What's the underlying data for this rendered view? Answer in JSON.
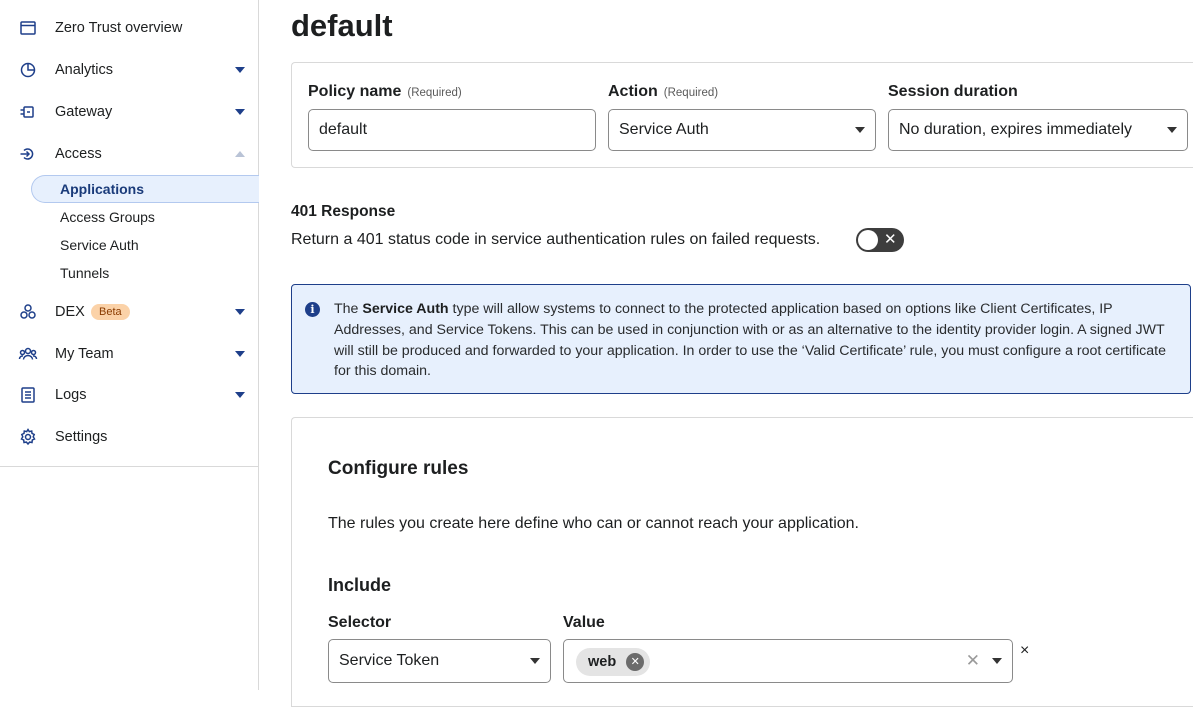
{
  "sidebar": {
    "items": [
      {
        "label": "Zero Trust overview",
        "icon": "browser-window-icon"
      },
      {
        "label": "Analytics",
        "icon": "pie-chart-icon",
        "expandable": true
      },
      {
        "label": "Gateway",
        "icon": "gateway-icon",
        "expandable": true
      },
      {
        "label": "Access",
        "icon": "access-icon",
        "expanded": true
      },
      {
        "label": "DEX",
        "icon": "dex-icon",
        "expandable": true,
        "badge": "Beta"
      },
      {
        "label": "My Team",
        "icon": "team-icon",
        "expandable": true
      },
      {
        "label": "Logs",
        "icon": "logs-icon",
        "expandable": true
      },
      {
        "label": "Settings",
        "icon": "gear-icon"
      }
    ],
    "access_subitems": [
      {
        "label": "Applications",
        "active": true
      },
      {
        "label": "Access Groups"
      },
      {
        "label": "Service Auth"
      },
      {
        "label": "Tunnels"
      }
    ]
  },
  "page": {
    "title": "default"
  },
  "policy": {
    "name_label": "Policy name",
    "name_required": "(Required)",
    "name_value": "default",
    "action_label": "Action",
    "action_required": "(Required)",
    "action_value": "Service Auth",
    "session_label": "Session duration",
    "session_value": "No duration, expires immediately"
  },
  "response401": {
    "title": "401 Response",
    "description": "Return a 401 status code in service authentication rules on failed requests.",
    "enabled": false
  },
  "info": {
    "icon": "info-icon",
    "bold": "Service Auth",
    "pre": "The ",
    "post": " type will allow systems to connect to the protected application based on options like Client Certificates, IP Addresses, and Service Tokens. This can be used in conjunction with or as an alternative to the identity provider login. A signed JWT will still be produced and forwarded to your application. In order to use the ‘Valid Certificate’ rule, you must configure a root certificate for this domain."
  },
  "rules": {
    "title": "Configure rules",
    "description": "The rules you create here define who can or cannot reach your application.",
    "include_title": "Include",
    "selector_label": "Selector",
    "selector_value": "Service Token",
    "value_label": "Value",
    "value_chip": "web",
    "remove_symbol": "×"
  },
  "colors": {
    "accent": "#1e3f8a",
    "info_bg": "#e7f0fd",
    "beta_bg": "#fbd2a8"
  }
}
